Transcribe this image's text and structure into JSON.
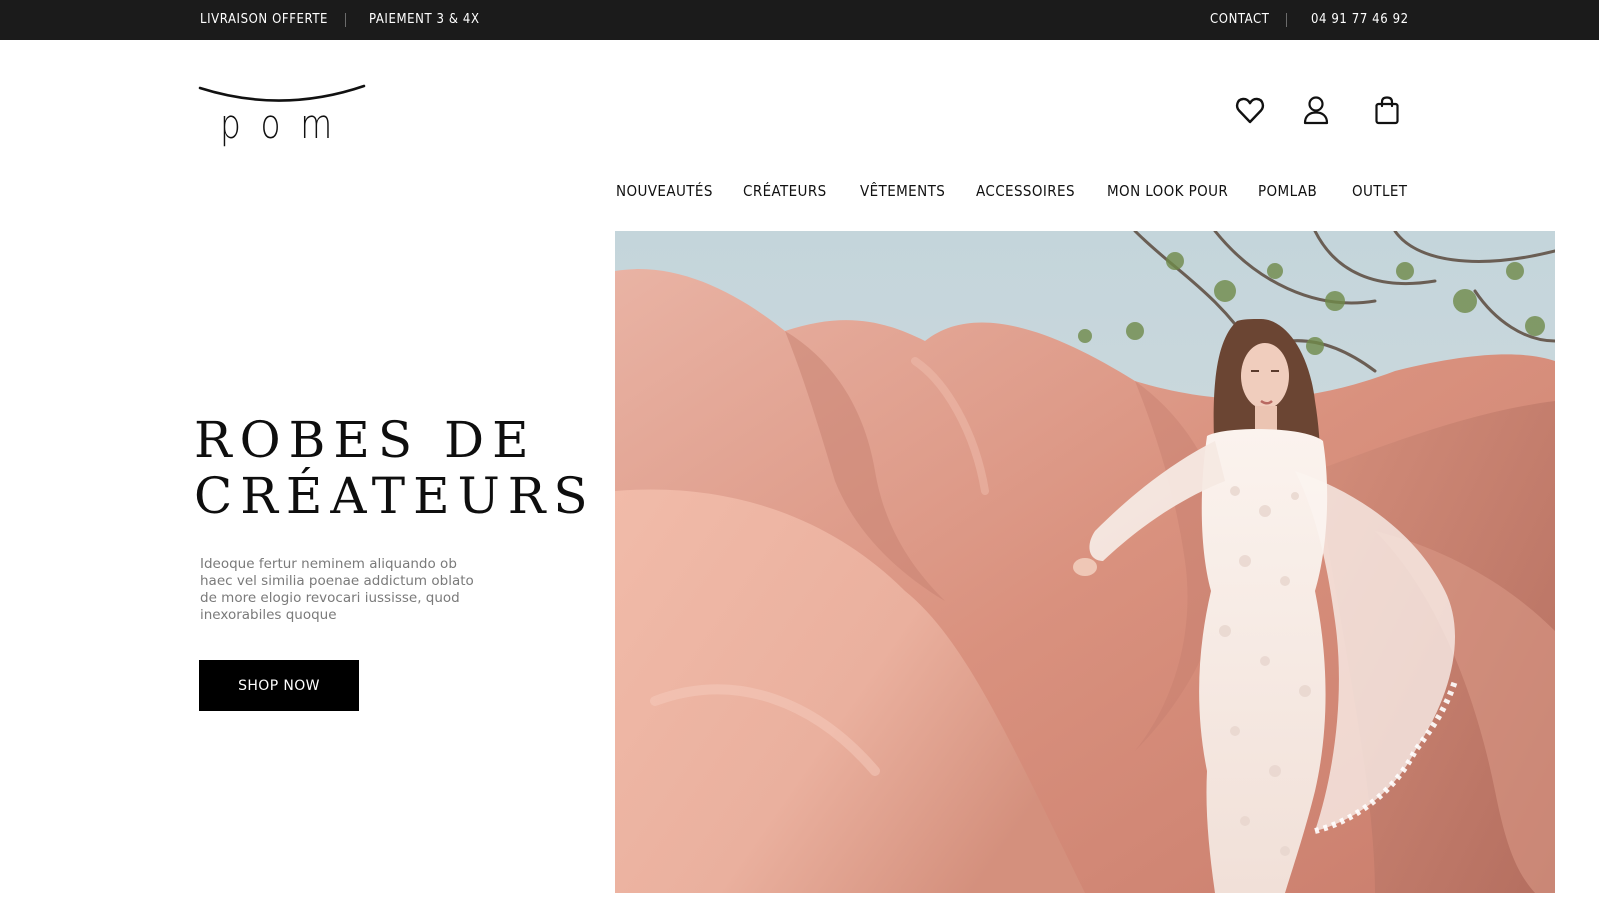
{
  "topbar": {
    "left_items": [
      "LIVRAISON OFFERTE",
      "PAIEMENT 3 & 4X"
    ],
    "right_items": [
      "CONTACT",
      "04 91 77 46 92"
    ]
  },
  "logo": {
    "text": "pom"
  },
  "header_icons": [
    "heart-icon",
    "user-icon",
    "shopping-bag-icon"
  ],
  "nav": {
    "items": [
      "NOUVEAUTÉS",
      "CRÉATEURS",
      "VÊTEMENTS",
      "ACCESSOIRES",
      "MON LOOK POUR",
      "POMLAB",
      "OUTLET"
    ]
  },
  "hero": {
    "title_line1": "ROBES DE",
    "title_line2": "CRÉATEURS",
    "description": "Ideoque fertur neminem aliquando ob haec vel similia poenae addictum oblato de more elogio revocari iussisse, quod inexorabiles quoque",
    "cta_label": "SHOP NOW"
  },
  "colors": {
    "topbar_bg": "#1b1b1b",
    "button_bg": "#000000",
    "fabric_pink": "#e2a18f",
    "sky": "#c9d7dc"
  }
}
